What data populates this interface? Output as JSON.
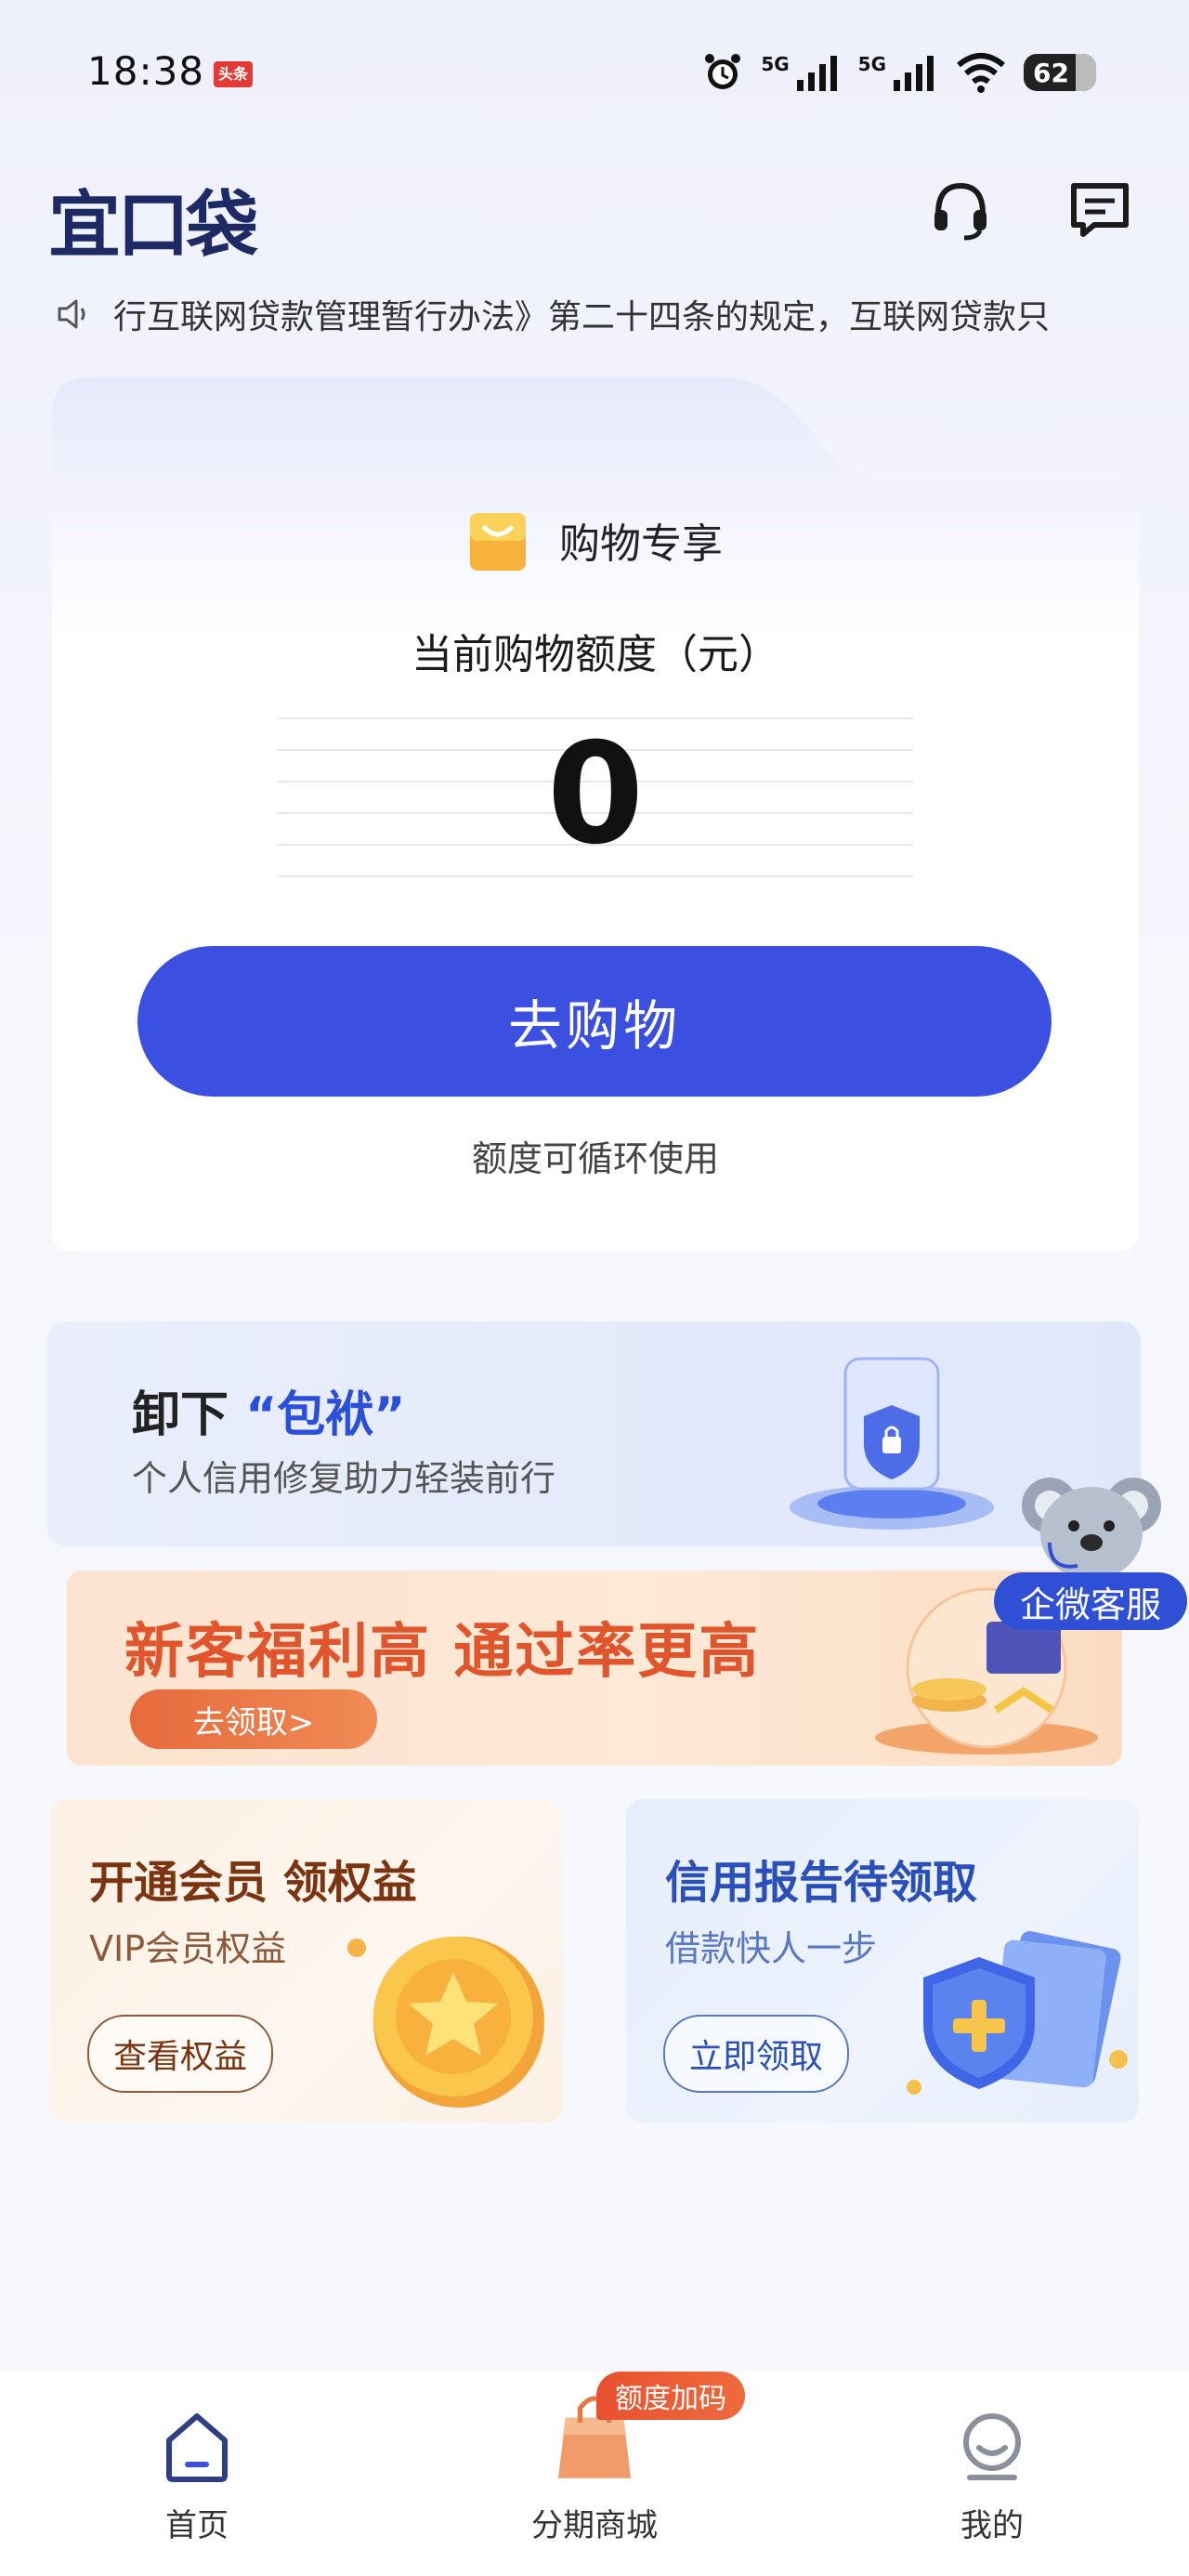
{
  "status_bar": {
    "time": "18:38",
    "badge": "头条",
    "net1": "5G",
    "net2": "5G",
    "wifi_sub": "6",
    "battery": "62"
  },
  "header": {
    "logo": "宜口袋",
    "service_icon": "headset-icon",
    "message_icon": "message-icon"
  },
  "notice": {
    "icon": "speaker-icon",
    "text": "行互联网贷款管理暂行办法》第二十四条的规定，互联网贷款只"
  },
  "card": {
    "title": "购物专享",
    "limit_label": "当前购物额度（元）",
    "limit_value": "0",
    "button": "去购物",
    "hint": "额度可循环使用"
  },
  "banner_credit": {
    "title_prefix": "卸下",
    "title_highlight": "“包袱”",
    "subtitle": "个人信用修复助力轻装前行"
  },
  "floating_service": {
    "label": "企微客服"
  },
  "banner_newuser": {
    "title": "新客福利高 通过率更高",
    "button": "去领取>"
  },
  "vip_card": {
    "title": "开通会员 领权益",
    "subtitle": "VIP会员权益",
    "button": "查看权益"
  },
  "report_card": {
    "title": "信用报告待领取",
    "subtitle": "借款快人一步",
    "button": "立即领取"
  },
  "bottom_nav": {
    "home": "首页",
    "mall": "分期商城",
    "mall_badge": "额度加码",
    "mine": "我的"
  },
  "colors": {
    "primary": "#3b50e0",
    "accent_orange": "#e0552b",
    "brand_navy": "#1d2a64"
  }
}
